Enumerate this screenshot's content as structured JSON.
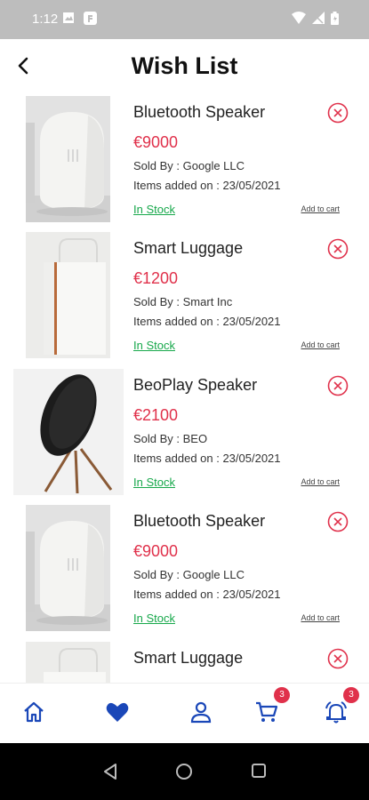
{
  "status_bar": {
    "time": "1:12"
  },
  "header": {
    "title": "Wish List"
  },
  "items": [
    {
      "name": "Bluetooth Speaker",
      "price": "€9000",
      "seller": "Sold By : Google LLC",
      "added": "Items added on : 23/05/2021",
      "stock": "In Stock",
      "cart_label": "Add to cart"
    },
    {
      "name": "Smart Luggage",
      "price": "€1200",
      "seller": "Sold By : Smart Inc",
      "added": "Items added on : 23/05/2021",
      "stock": "In Stock",
      "cart_label": "Add to cart"
    },
    {
      "name": "BeoPlay Speaker",
      "price": "€2100",
      "seller": "Sold By : BEO",
      "added": "Items added on : 23/05/2021",
      "stock": "In Stock",
      "cart_label": "Add to cart"
    },
    {
      "name": "Bluetooth Speaker",
      "price": "€9000",
      "seller": "Sold By : Google LLC",
      "added": "Items added on : 23/05/2021",
      "stock": "In Stock",
      "cart_label": "Add to cart"
    },
    {
      "name": "Smart Luggage"
    }
  ],
  "bottom_nav": {
    "cart_badge": "3",
    "notifications_badge": "3"
  },
  "colors": {
    "accent_blue": "#1a47b8",
    "price_red": "#e0314b",
    "stock_green": "#17a84b"
  }
}
